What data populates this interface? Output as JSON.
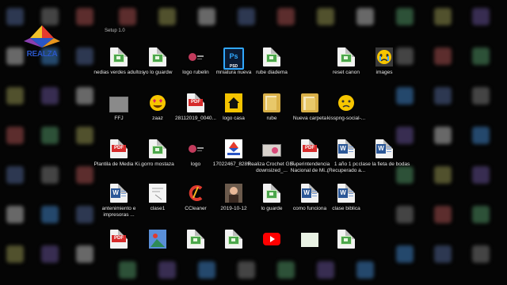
{
  "desktop": {
    "logo_text": "REALZA",
    "top_partial_label": "Setup 1.0",
    "icons": [
      {
        "label": "nedias verdes adultos",
        "type": "app"
      },
      {
        "label": "yo lo guardw",
        "type": "app"
      },
      {
        "label": "logo rubelin",
        "type": "logo"
      },
      {
        "label": "mniatura nueva",
        "type": "psd"
      },
      {
        "label": "rube diadema",
        "type": "app"
      },
      {
        "label": "reset canon",
        "type": "app"
      },
      {
        "label": "images",
        "type": "emoji-cry"
      },
      {
        "label": "FFJ",
        "type": "thumb"
      },
      {
        "label": "zaaz",
        "type": "emoji-love"
      },
      {
        "label": "28112019_0040...",
        "type": "pdf"
      },
      {
        "label": "logo casa",
        "type": "warning"
      },
      {
        "label": "rube",
        "type": "folder"
      },
      {
        "label": "Nueva carpeta",
        "type": "folder"
      },
      {
        "label": "kisspng-social-...",
        "type": "emoji-sad"
      },
      {
        "label": "Plantila de Media Ki...",
        "type": "pdf"
      },
      {
        "label": "gorro mostaza",
        "type": "app"
      },
      {
        "label": "logo",
        "type": "logo"
      },
      {
        "label": "17022467_8289...",
        "type": "realza"
      },
      {
        "label": "Realiza Crochet GIF-downsized_...",
        "type": "image"
      },
      {
        "label": "Superintendencia Nacional de Mi...",
        "type": "pdf"
      },
      {
        "label": "1 año 1 pc (Recuperado a...",
        "type": "word"
      },
      {
        "label": "clase la fieta de bodas",
        "type": "word"
      },
      {
        "label": "antenimiento e impresoras ...",
        "type": "word"
      },
      {
        "label": "clase1",
        "type": "doc"
      },
      {
        "label": "CCleaner",
        "type": "ccleaner"
      },
      {
        "label": "2019-10-12",
        "type": "photo"
      },
      {
        "label": "lo guarde",
        "type": "app"
      },
      {
        "label": "como funciona",
        "type": "word"
      },
      {
        "label": "clase biblica",
        "type": "word"
      },
      {
        "label": "",
        "type": "pdf"
      },
      {
        "label": "",
        "type": "image"
      },
      {
        "label": "",
        "type": "app"
      },
      {
        "label": "",
        "type": "app"
      },
      {
        "label": "",
        "type": "youtube"
      },
      {
        "label": "",
        "type": "image"
      },
      {
        "label": "",
        "type": "app"
      }
    ],
    "ps_text": "Ps",
    "ps_sub": "PSD",
    "pdf_text": "PDF",
    "word_text": "W"
  }
}
